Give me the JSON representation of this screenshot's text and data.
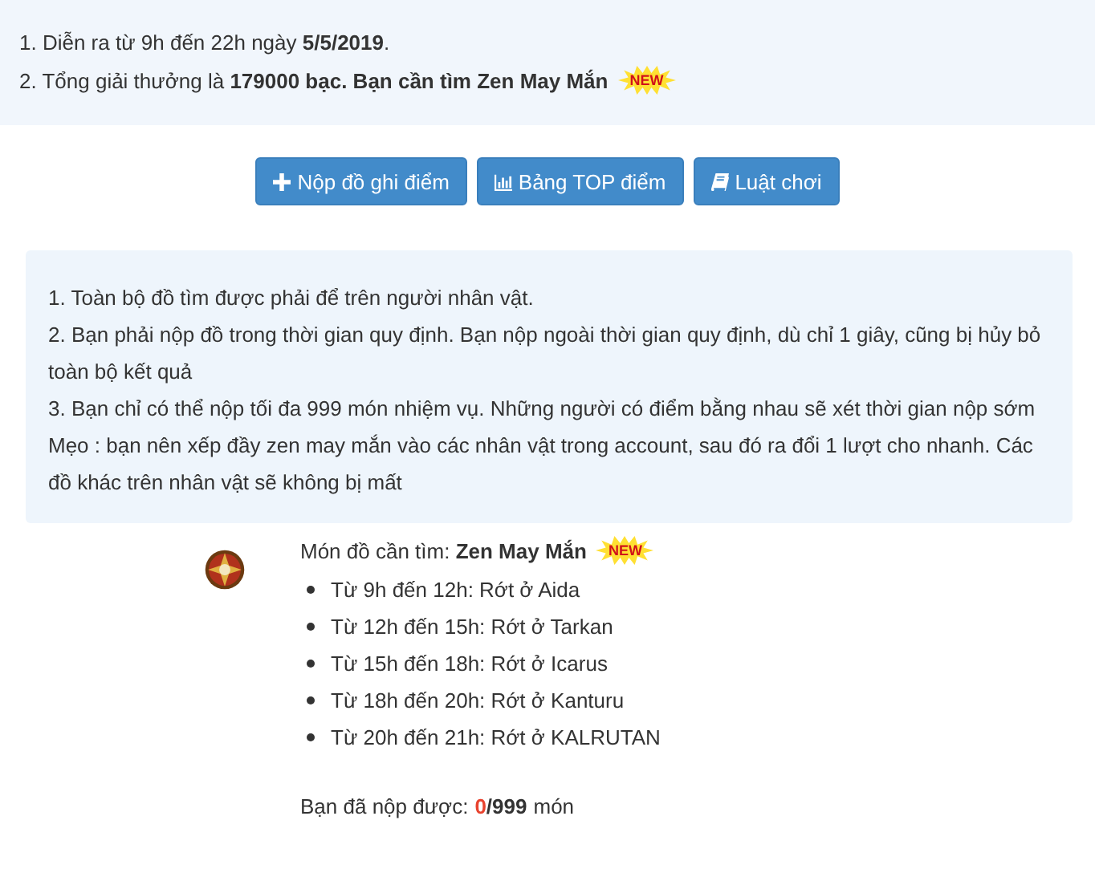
{
  "notice": {
    "lines": [
      "1. Diễn ra từ 9h đến 22h ngày **5/5/2019**.",
      "2. Tổng giải thưởng là **179000 bạc. Bạn cần tìm Zen May Mắn**"
    ],
    "badge": "NEW"
  },
  "buttons": [
    {
      "kind": "add",
      "label": "Nộp đồ ghi điểm"
    },
    {
      "kind": "ranking",
      "label": "Bảng TOP điểm"
    },
    {
      "kind": "rules",
      "label": "Luật chơi"
    }
  ],
  "rules": [
    "1. Toàn bộ đồ tìm được phải để trên người nhân vật.",
    "2. Bạn phải nộp đồ trong thời gian quy định. Bạn nộp ngoài thời gian quy định, dù chỉ 1 giây, cũng bị hủy bỏ toàn bộ kết quả",
    "3. Bạn chỉ có thể nộp tối đa 999 món nhiệm vụ. Những người có điểm bằng nhau sẽ xét thời gian nộp sớm",
    "Mẹo : bạn nên xếp đầy zen may mắn vào các nhân vật trong account, sau đó ra đổi 1 lượt cho nhanh. Các đồ khác trên nhân vật sẽ không bị mất"
  ],
  "item": {
    "title": "Món đồ cần tìm: **Zen May Mắn**",
    "badge": "NEW",
    "drops": [
      "Từ 9h đến 12h: Rớt ở Aida",
      "Từ 12h đến 15h: Rớt ở Tarkan",
      "Từ 15h đến 18h: Rớt ở Icarus",
      "Từ 18h đến 20h: Rớt ở Kanturu",
      "Từ 20h đến 21h: Rớt ở KALRUTAN"
    ],
    "progress": {
      "label": "Bạn đã nộp được:",
      "count": "0",
      "total": "/999",
      "unit": "món"
    }
  }
}
